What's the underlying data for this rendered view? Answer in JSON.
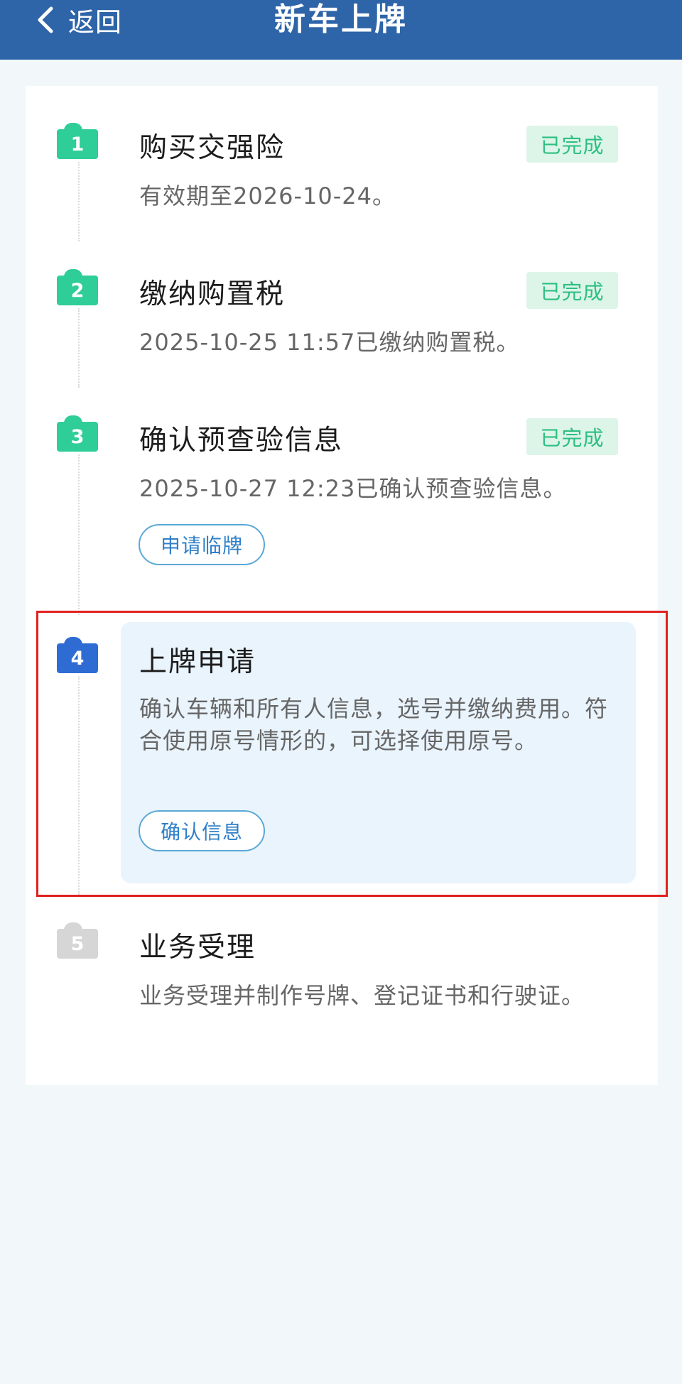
{
  "header": {
    "back_label": "返回",
    "title": "新车上牌",
    "background_color": "#2e64a8"
  },
  "steps": [
    {
      "number": "1",
      "title": "购买交强险",
      "description": "有效期至2026-10-24。",
      "status": "已完成",
      "state": "completed"
    },
    {
      "number": "2",
      "title": "缴纳购置税",
      "description": "2025-10-25 11:57已缴纳购置税。",
      "status": "已完成",
      "state": "completed"
    },
    {
      "number": "3",
      "title": "确认预查验信息",
      "description": "2025-10-27 12:23已确认预查验信息。",
      "status": "已完成",
      "state": "completed",
      "action_label": "申请临牌"
    },
    {
      "number": "4",
      "title": "上牌申请",
      "description": "确认车辆和所有人信息，选号并缴纳费用。符合使用原号情形的，可选择使用原号。",
      "state": "active",
      "action_label": "确认信息"
    },
    {
      "number": "5",
      "title": "业务受理",
      "description": "业务受理并制作号牌、登记证书和行驶证。",
      "state": "pending"
    }
  ],
  "colors": {
    "completed": "#2fcd98",
    "active": "#2e6cd4",
    "pending": "#d6d6d6",
    "highlight_border": "#e0201f"
  }
}
